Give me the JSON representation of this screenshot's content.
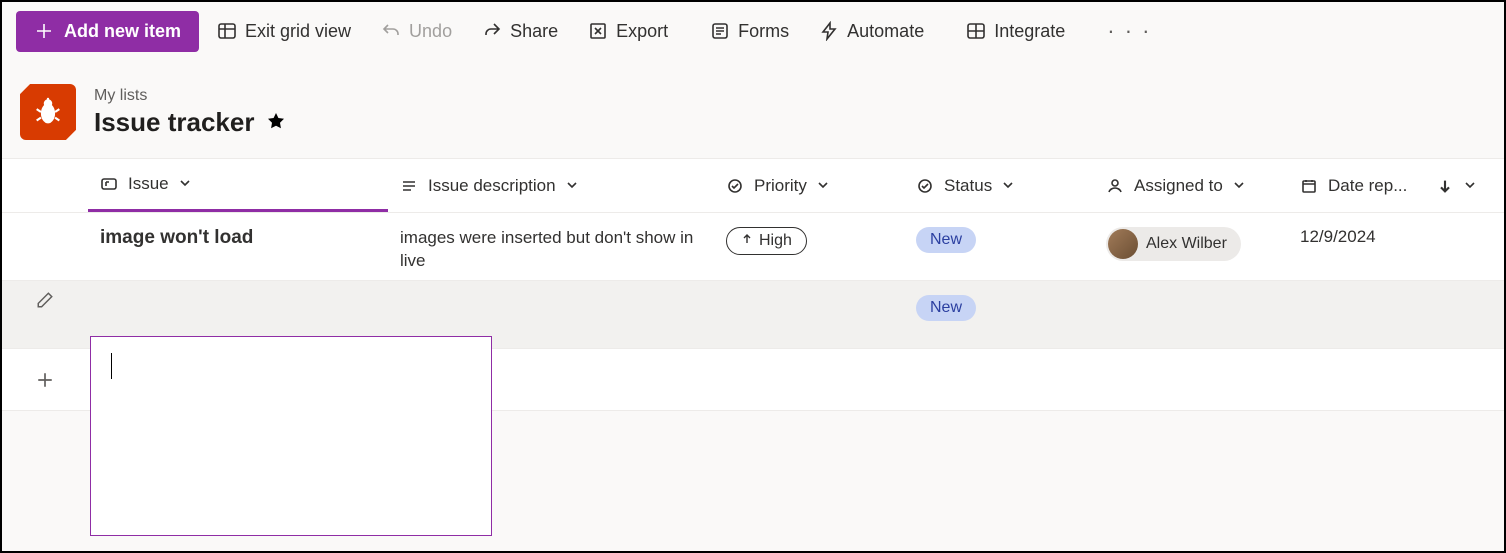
{
  "toolbar": {
    "add_label": "Add new item",
    "exit_grid_label": "Exit grid view",
    "undo_label": "Undo",
    "share_label": "Share",
    "export_label": "Export",
    "forms_label": "Forms",
    "automate_label": "Automate",
    "integrate_label": "Integrate"
  },
  "breadcrumb": "My lists",
  "list_title": "Issue tracker",
  "columns": {
    "issue": "Issue",
    "description": "Issue description",
    "priority": "Priority",
    "status": "Status",
    "assigned": "Assigned to",
    "date_reported": "Date rep..."
  },
  "rows": [
    {
      "issue": "image won't load",
      "description": "images were inserted but don't show in live",
      "priority": "High",
      "status": "New",
      "assigned": "Alex Wilber",
      "date_reported": "12/9/2024"
    },
    {
      "issue": "",
      "description": "",
      "priority": "",
      "status": "New",
      "assigned": "",
      "date_reported": ""
    }
  ],
  "colors": {
    "accent": "#8f2da5",
    "list_icon_bg": "#d83b01",
    "status_new_bg": "#c7d4f5",
    "status_new_fg": "#2b3fa0"
  }
}
